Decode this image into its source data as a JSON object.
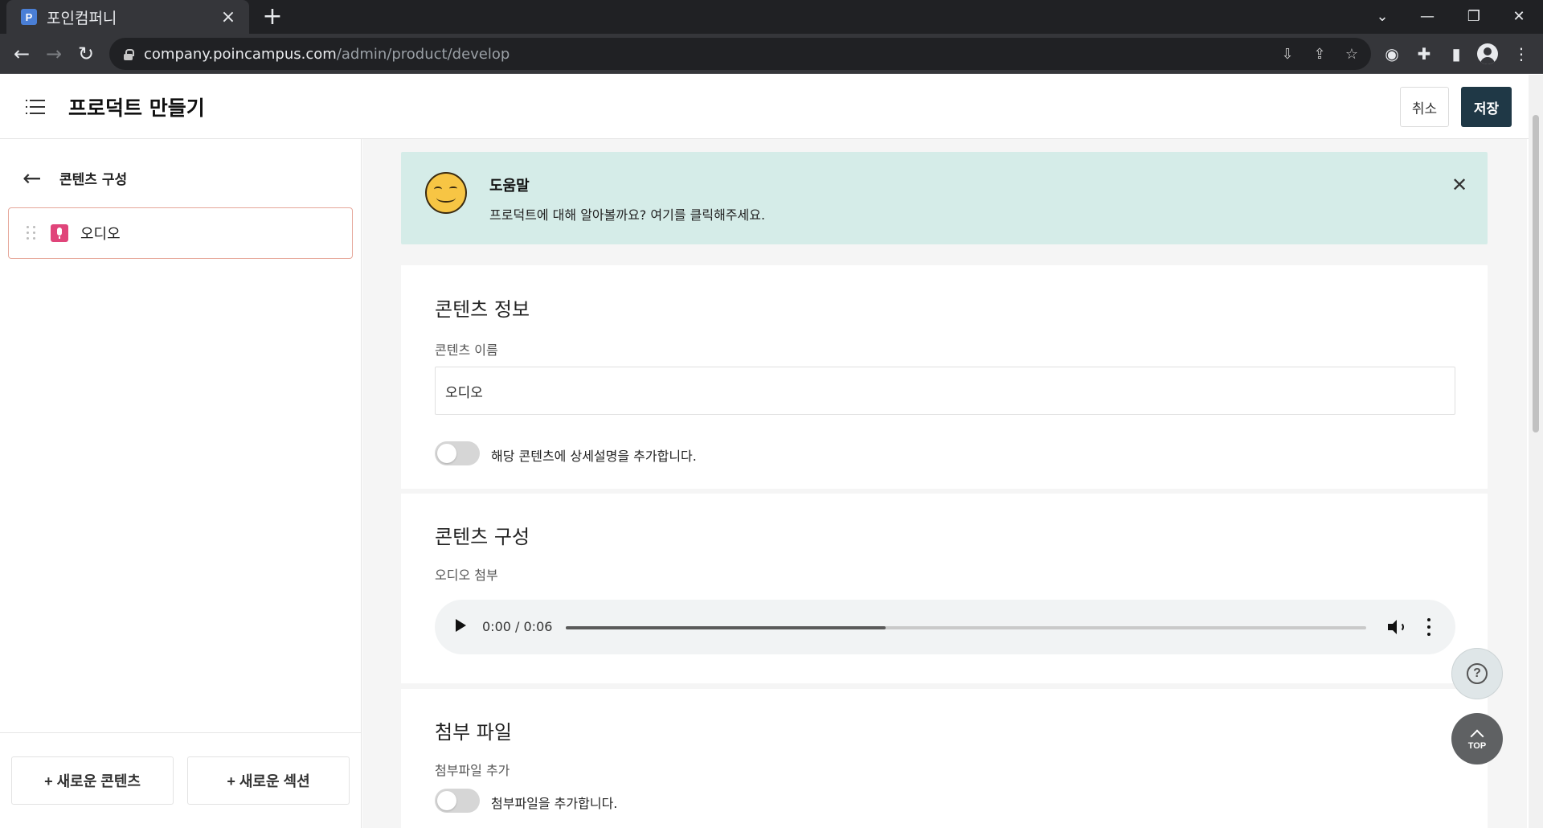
{
  "browser": {
    "tab_title": "포인컴퍼니",
    "favicon_letter": "P",
    "url_host": "company.poincampus.com",
    "url_path": "/admin/product/develop"
  },
  "header": {
    "title": "프로덕트 만들기",
    "cancel_label": "취소",
    "save_label": "저장"
  },
  "sidebar": {
    "back_label": "콘텐츠 구성",
    "items": [
      {
        "label": "오디오",
        "type": "audio"
      }
    ],
    "new_content_label": "+ 새로운 콘텐츠",
    "new_section_label": "+ 새로운 섹션"
  },
  "help": {
    "title": "도움말",
    "text": "프로덕트에 대해 알아볼까요? 여기를 클릭해주세요."
  },
  "content_info": {
    "title": "콘텐츠 정보",
    "name_label": "콘텐츠 이름",
    "name_value": "오디오",
    "detail_toggle_label": "해당 콘텐츠에 상세설명을 추가합니다.",
    "detail_toggle_on": false
  },
  "content_compose": {
    "title": "콘텐츠 구성",
    "audio_label": "오디오 첨부",
    "audio_time": "0:00 / 0:06",
    "audio_buffered_fraction": 0.4
  },
  "attachments": {
    "title": "첨부 파일",
    "add_label": "첨부파일 추가",
    "toggle_label": "첨부파일을 추가합니다.",
    "toggle_on": false
  },
  "fab": {
    "top_label": "TOP",
    "help_glyph": "?"
  },
  "colors": {
    "save_button": "#1f3846",
    "help_banner": "#d5ece8",
    "selected_item_border": "#e6a79a",
    "audio_badge": "#e0457a"
  }
}
